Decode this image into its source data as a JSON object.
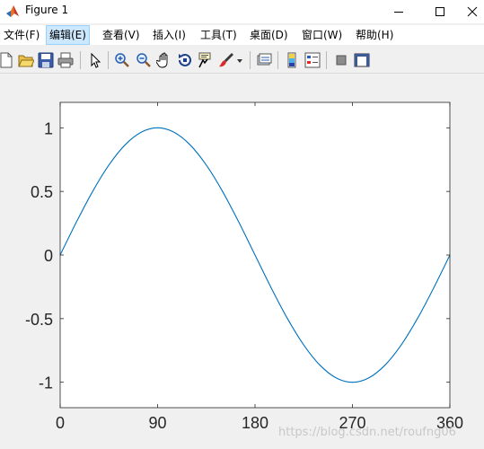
{
  "window": {
    "title": "Figure 1"
  },
  "menu": {
    "items": [
      {
        "label": "文件(F)"
      },
      {
        "label": "编辑(E)"
      },
      {
        "label": "查看(V)"
      },
      {
        "label": "插入(I)"
      },
      {
        "label": "工具(T)"
      },
      {
        "label": "桌面(D)"
      },
      {
        "label": "窗口(W)"
      },
      {
        "label": "帮助(H)"
      }
    ],
    "active_index": 1
  },
  "toolbar": {
    "icons": [
      "new-figure-icon",
      "open-file-icon",
      "save-icon",
      "print-icon",
      "pointer-icon",
      "zoom-in-icon",
      "zoom-out-icon",
      "pan-hand-icon",
      "rotate-3d-icon",
      "data-cursor-icon",
      "brush-icon",
      "brush-dropdown-icon",
      "link-plot-icon",
      "insert-colorbar-icon",
      "insert-legend-icon",
      "hide-plot-tools-icon",
      "show-plot-tools-icon"
    ]
  },
  "watermark": "https://blog.csdn.net/roufng06",
  "chart_data": {
    "type": "line",
    "title": "",
    "xlabel": "",
    "ylabel": "",
    "xlim": [
      0,
      360
    ],
    "ylim": [
      -1.2,
      1.2
    ],
    "xticks": [
      0,
      90,
      180,
      270,
      360
    ],
    "yticks": [
      1,
      0.5,
      0,
      -0.5,
      -1
    ],
    "xtick_labels": [
      "0",
      "90",
      "180",
      "270",
      "360"
    ],
    "ytick_labels": [
      "1",
      "0.5",
      "0",
      "-0.5",
      "-1"
    ],
    "grid": false,
    "series": [
      {
        "color": "#0072bd",
        "x": [
          0,
          15,
          30,
          45,
          60,
          75,
          90,
          105,
          120,
          135,
          150,
          165,
          180,
          195,
          210,
          225,
          240,
          255,
          270,
          285,
          300,
          315,
          330,
          345,
          360
        ],
        "y": [
          0,
          0.259,
          0.5,
          0.707,
          0.866,
          0.966,
          1,
          0.966,
          0.866,
          0.707,
          0.5,
          0.259,
          0,
          -0.259,
          -0.5,
          -0.707,
          -0.866,
          -0.966,
          -1,
          -0.966,
          -0.866,
          -0.707,
          -0.5,
          -0.259,
          0
        ]
      }
    ]
  }
}
